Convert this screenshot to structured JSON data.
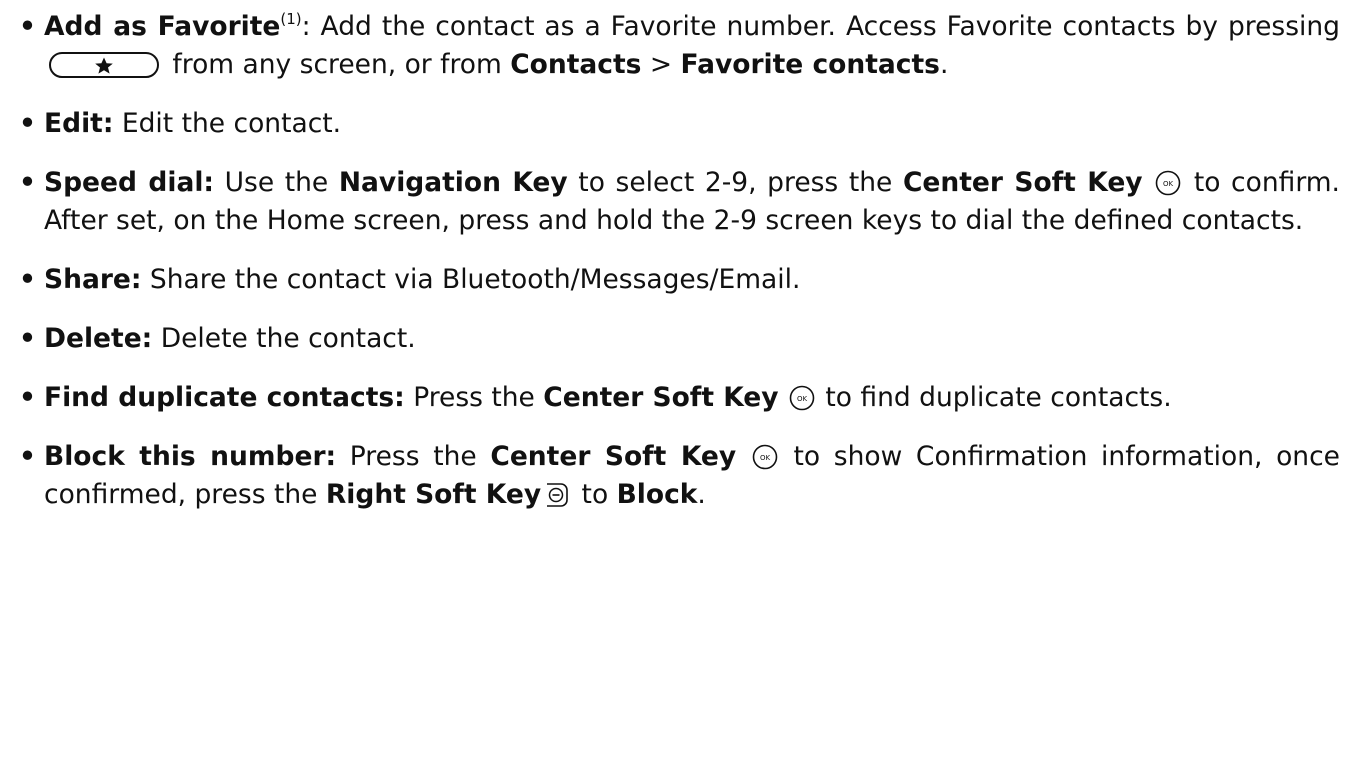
{
  "icons": {
    "bullet": "•",
    "favorite_key": "star-key-icon",
    "center_soft_key": "ok-key-icon",
    "right_soft_key": "right-soft-key-icon"
  },
  "items": [
    {
      "title": "Add as Favorite",
      "footnote": "(1)",
      "t1": ": Add the contact as a Favorite number. Access Favorite contacts by pressing ",
      "t2": " from any screen, or from ",
      "b1": "Contacts",
      "t3": " > ",
      "b2": "Favorite contacts",
      "t4": "."
    },
    {
      "title": "Edit:",
      "t1": " Edit the contact."
    },
    {
      "title": "Speed dial:",
      "t1": " Use the ",
      "b1": "Navigation Key",
      "t2": " to select 2-9, press the ",
      "b2": "Center Soft Key",
      "t3": " ",
      "t4": " to confirm. After set, on the Home screen, press and hold the 2-9 screen keys to dial the defined contacts."
    },
    {
      "title": "Share:",
      "t1": " Share the contact via Bluetooth/Messages/Email."
    },
    {
      "title": "Delete:",
      "t1": " Delete the contact."
    },
    {
      "title": "Find duplicate contacts:",
      "t1": " Press the ",
      "b1": "Center Soft Key",
      "t2": " to find duplicate contacts."
    },
    {
      "title": "Block this number:",
      "t1": " Press the ",
      "b1": "Center Soft Key",
      "t2": " to show Confirmation information, once confirmed, press the ",
      "b2": "Right Soft Key",
      "t3": " to ",
      "b3": "Block",
      "t4": "."
    }
  ]
}
